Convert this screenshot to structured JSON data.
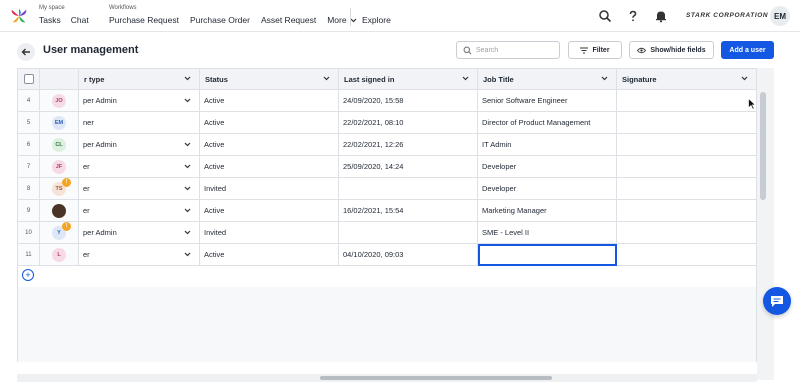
{
  "topbar": {
    "space_label": "My space",
    "space_links": [
      "Tasks",
      "Chat"
    ],
    "workflows_label": "Workflows",
    "workflow_links": [
      "Purchase Request",
      "Purchase Order",
      "Asset Request"
    ],
    "more_label": "More",
    "explore_label": "Explore",
    "brand": "STARK CORPORATION",
    "user_initials": "EM"
  },
  "page": {
    "title": "User management",
    "search_placeholder": "Search",
    "filter_label": "Filter",
    "show_hide_label": "Show/hide fields",
    "add_user_label": "Add a user"
  },
  "table": {
    "columns": [
      "r type",
      "Status",
      "Last signed in",
      "Job Title",
      "Signature"
    ],
    "rows": [
      {
        "num": "4",
        "initials": "JO",
        "avatar_color": "#f6dbe7",
        "avatar_text": "#b0366e",
        "badge": "",
        "type": "per Admin",
        "has_dropdown": true,
        "status": "Active",
        "last": "24/09/2020, 15:58",
        "job": "Senior Software Engineer"
      },
      {
        "num": "5",
        "initials": "EM",
        "avatar_color": "#dde7f7",
        "avatar_text": "#2b5fb3",
        "badge": "",
        "type": "ner",
        "has_dropdown": false,
        "status": "Active",
        "last": "22/02/2021, 08:10",
        "job": "Director of Product Management"
      },
      {
        "num": "6",
        "initials": "CL",
        "avatar_color": "#dcefe0",
        "avatar_text": "#2f7a3e",
        "badge": "",
        "type": "per Admin",
        "has_dropdown": true,
        "status": "Active",
        "last": "22/02/2021, 12:26",
        "job": "IT Admin"
      },
      {
        "num": "7",
        "initials": "JF",
        "avatar_color": "#f6dbe7",
        "avatar_text": "#b0366e",
        "badge": "",
        "type": "er",
        "has_dropdown": true,
        "status": "Active",
        "last": "25/09/2020, 14:24",
        "job": "Developer"
      },
      {
        "num": "8",
        "initials": "TS",
        "avatar_color": "#f7e4d8",
        "avatar_text": "#a3552a",
        "badge": "!",
        "type": "er",
        "has_dropdown": true,
        "status": "Invited",
        "last": "",
        "job": "Developer"
      },
      {
        "num": "9",
        "initials": "",
        "avatar_color": "#4a3427",
        "avatar_text": "#ffffff",
        "badge": "",
        "type": "er",
        "has_dropdown": true,
        "status": "Active",
        "last": "16/02/2021, 15:54",
        "job": "Marketing Manager"
      },
      {
        "num": "10",
        "initials": "Y",
        "avatar_color": "#dde7f7",
        "avatar_text": "#2b5fb3",
        "badge": "!",
        "type": "per Admin",
        "has_dropdown": true,
        "status": "Invited",
        "last": "",
        "job": "SME - Level II"
      },
      {
        "num": "11",
        "initials": "L",
        "avatar_color": "#f6dbe7",
        "avatar_text": "#b0366e",
        "badge": "",
        "type": "er",
        "has_dropdown": true,
        "status": "Active",
        "last": "04/10/2020, 09:03",
        "job": ""
      }
    ]
  },
  "colors": {
    "accent": "#1357e3",
    "border": "#dde1e6"
  }
}
